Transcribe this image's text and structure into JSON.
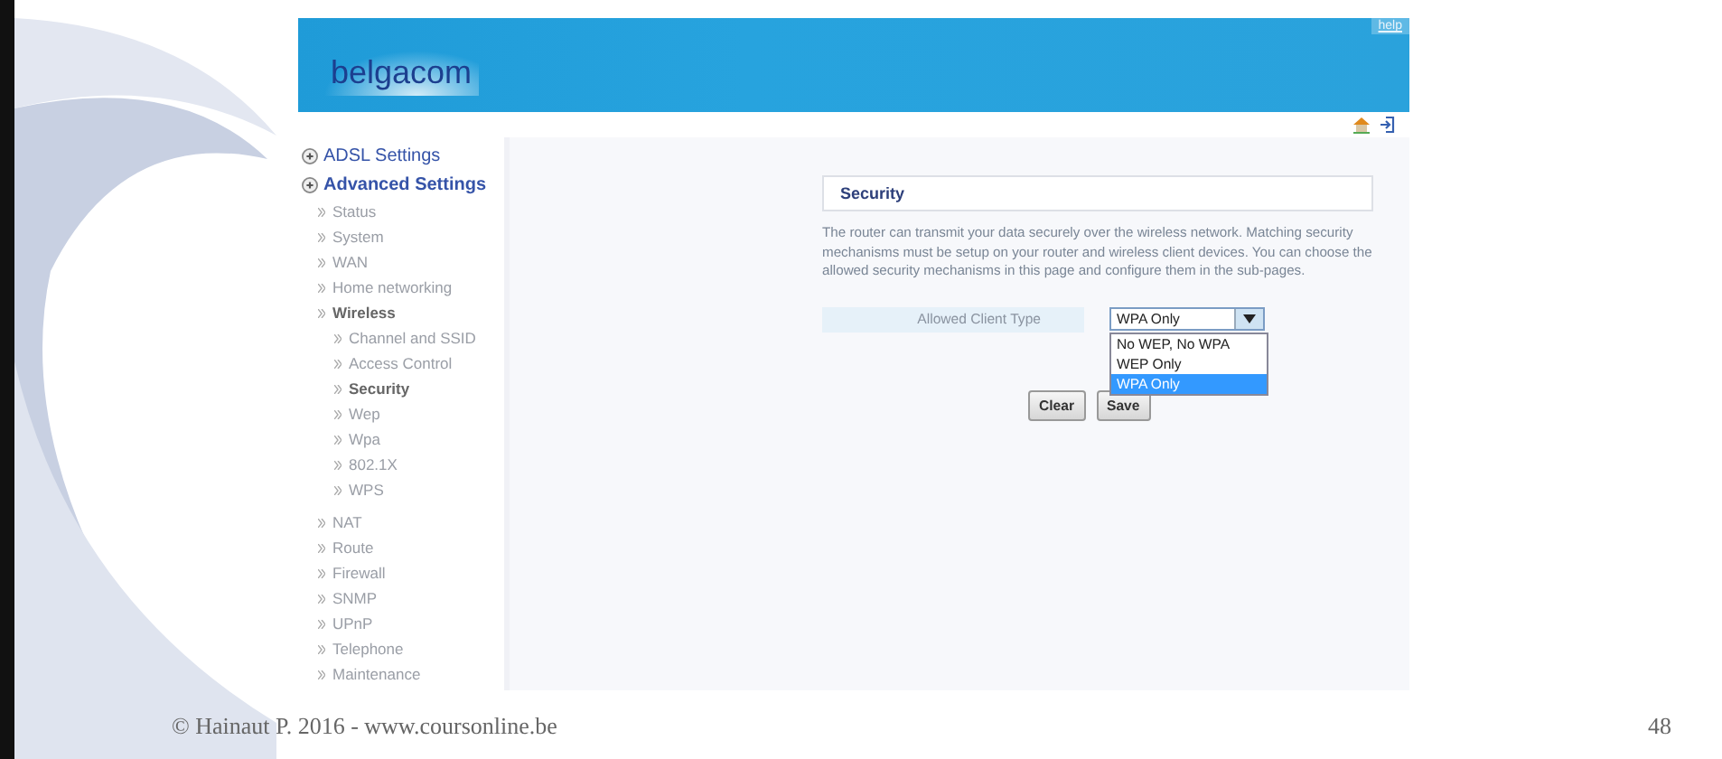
{
  "header": {
    "logo": "belgacom",
    "help": "help"
  },
  "sidebar": {
    "items": [
      {
        "label": "ADSL Settings",
        "expanded": false
      },
      {
        "label": "Advanced Settings",
        "expanded": true,
        "children": [
          {
            "label": "Status",
            "selected": false
          },
          {
            "label": "System",
            "selected": false
          },
          {
            "label": "WAN",
            "selected": false
          },
          {
            "label": "Home networking",
            "selected": false
          },
          {
            "label": "Wireless",
            "selected": false,
            "expanded": true,
            "children": [
              {
                "label": "Channel and SSID",
                "selected": false
              },
              {
                "label": "Access Control",
                "selected": false
              },
              {
                "label": "Security",
                "selected": true
              },
              {
                "label": "Wep",
                "selected": false
              },
              {
                "label": "Wpa",
                "selected": false
              },
              {
                "label": "802.1X",
                "selected": false
              },
              {
                "label": "WPS",
                "selected": false
              }
            ]
          },
          {
            "label": "NAT",
            "selected": false
          },
          {
            "label": "Route",
            "selected": false
          },
          {
            "label": "Firewall",
            "selected": false
          },
          {
            "label": "SNMP",
            "selected": false
          },
          {
            "label": "UPnP",
            "selected": false
          },
          {
            "label": "Telephone",
            "selected": false
          },
          {
            "label": "Maintenance",
            "selected": false
          }
        ]
      }
    ]
  },
  "content": {
    "title": "Security",
    "description": "The router can transmit your data securely over the wireless network. Matching security mechanisms must be setup on your router and wireless client devices. You can choose the allowed security mechanisms in this page and configure them in the sub-pages.",
    "field": {
      "label": "Allowed Client Type",
      "value": "WPA Only",
      "open": true,
      "options": [
        {
          "label": "No WEP, No WPA",
          "selected": false
        },
        {
          "label": "WEP Only",
          "selected": false
        },
        {
          "label": "WPA Only",
          "selected": true
        }
      ]
    },
    "buttons": [
      "Clear",
      "Save"
    ]
  },
  "footer": {
    "credit": "© Hainaut P. 2016 - www.coursonline.be",
    "page": "48"
  }
}
